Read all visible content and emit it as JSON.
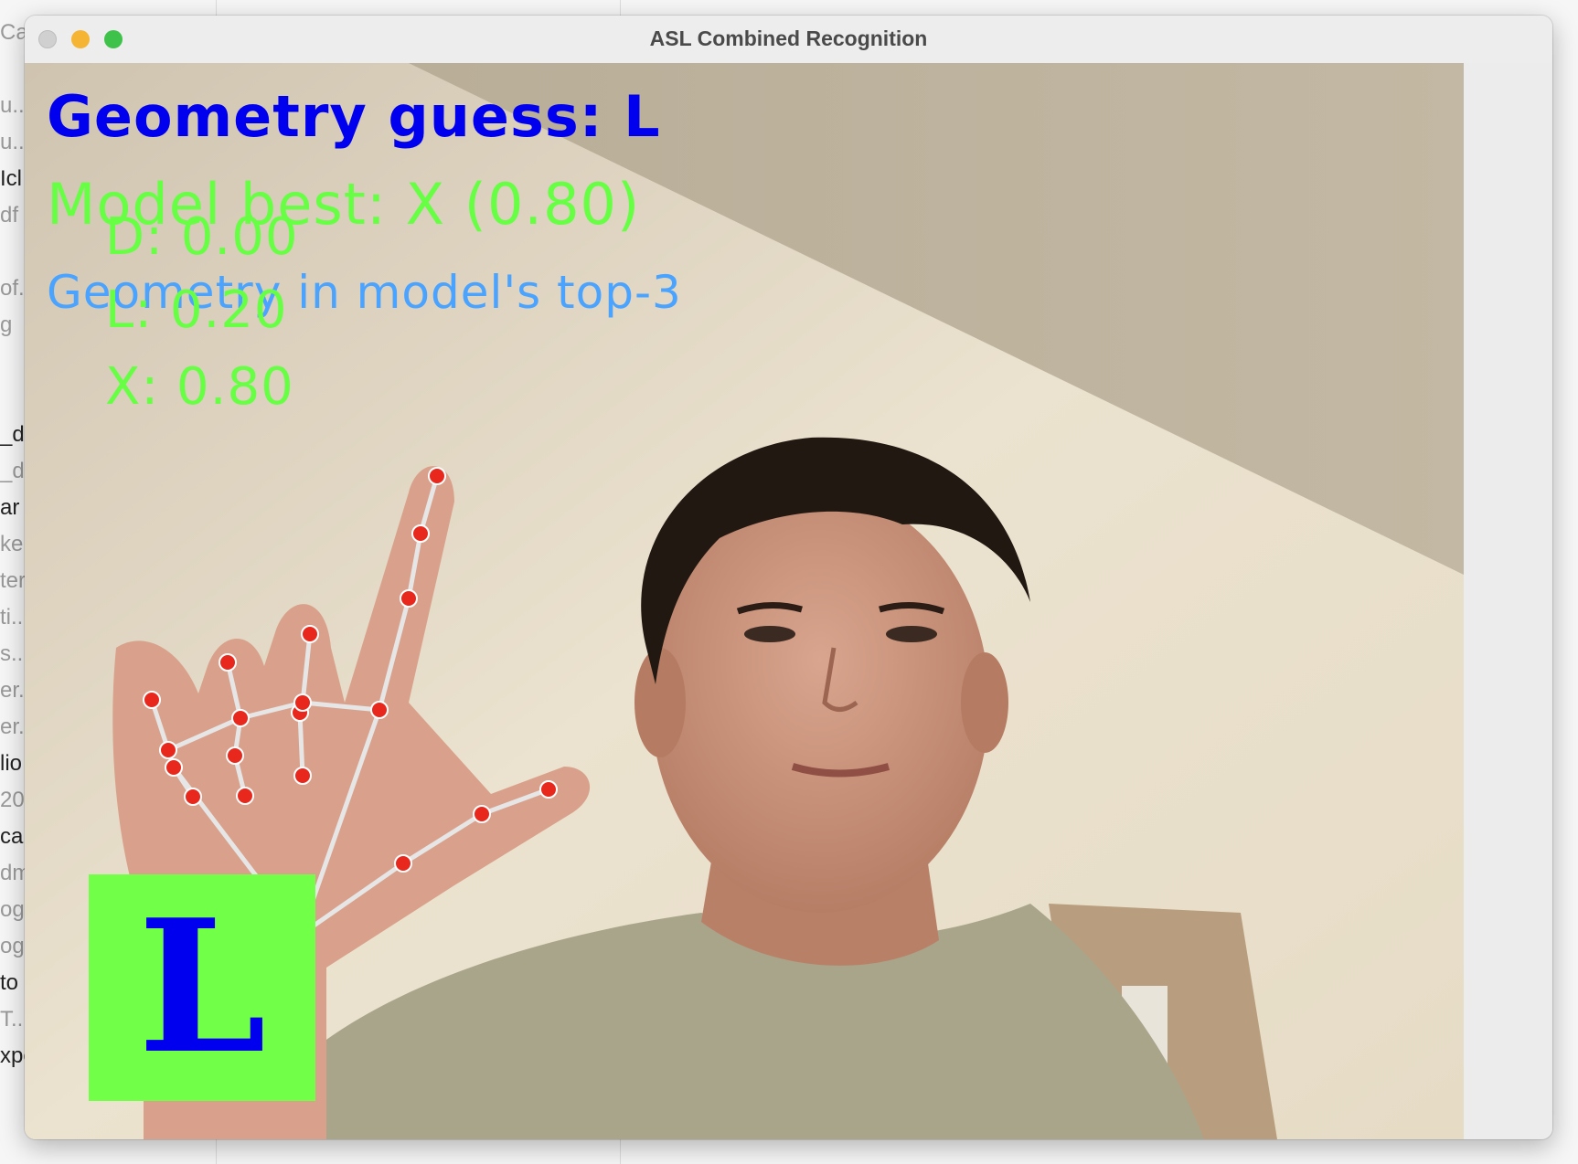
{
  "background_app": {
    "list_items": [
      {
        "text": "Ca",
        "dark": false
      },
      {
        "text": "u...",
        "dark": false
      },
      {
        "text": "u...",
        "dark": false
      },
      {
        "text": "Icl",
        "dark": true
      },
      {
        "text": "df",
        "dark": false
      },
      {
        "text": "of...",
        "dark": false
      },
      {
        "text": "g",
        "dark": false
      },
      {
        "text": "_dl",
        "dark": true
      },
      {
        "text": "_dl",
        "dark": false
      },
      {
        "text": "ar",
        "dark": true
      },
      {
        "text": "ke",
        "dark": false
      },
      {
        "text": "teri",
        "dark": false
      },
      {
        "text": "ti...",
        "dark": false
      },
      {
        "text": "s...",
        "dark": false
      },
      {
        "text": "er...",
        "dark": false
      },
      {
        "text": "er...",
        "dark": false
      },
      {
        "text": "lio",
        "dark": true
      },
      {
        "text": "20",
        "dark": false
      },
      {
        "text": "ca",
        "dark": true
      },
      {
        "text": "dm",
        "dark": false
      },
      {
        "text": "og'",
        "dark": false
      },
      {
        "text": "og:",
        "dark": false
      },
      {
        "text": "to",
        "dark": true
      },
      {
        "text": "T...",
        "dark": false
      },
      {
        "text": "xpe",
        "dark": true
      }
    ]
  },
  "window": {
    "title": "ASL Combined Recognition"
  },
  "overlay": {
    "geometry_guess": "Geometry guess: L",
    "model_best": "Model best: X (0.80)",
    "top3_note": "Geometry in model's top-3",
    "probabilities": [
      "D: 0.00",
      "L: 0.20",
      "X: 0.80"
    ],
    "letter": "L"
  },
  "colors": {
    "geometry_text": "#0000ee",
    "model_text": "#66ff44",
    "top3_text": "#4aa3ff",
    "letter_box_bg": "#72ff48",
    "landmark_point": "#e8281c",
    "landmark_line": "#e6e6e6"
  },
  "icons": [
    "close-traffic-light-icon",
    "minimize-traffic-light-icon",
    "maximize-traffic-light-icon"
  ]
}
